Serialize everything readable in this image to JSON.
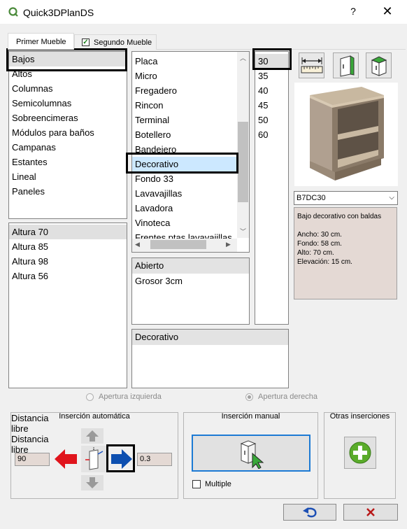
{
  "window": {
    "title": "Quick3DPlanDS",
    "help": "?",
    "close": "✕"
  },
  "tabs": [
    {
      "label": "Primer Mueble"
    },
    {
      "label": "Segundo Mueble",
      "checked": true
    }
  ],
  "categories": [
    "Bajos",
    "Altos",
    "Columnas",
    "Semicolumnas",
    "Sobreencimeras",
    "Módulos para baños",
    "Campanas",
    "Estantes",
    "Lineal",
    "Paneles"
  ],
  "heights": [
    "Altura 70",
    "Altura 85",
    "Altura 98",
    "Altura 56"
  ],
  "subtypes": [
    "Placa",
    "Micro",
    "Fregadero",
    "Rincon",
    "Terminal",
    "Botellero",
    "Bandejero",
    "Decorativo",
    "Fondo 33",
    "Lavavajillas",
    "Lavadora",
    "Vinoteca",
    "Frentes ptas lavavajillas"
  ],
  "widths": [
    "30",
    "35",
    "40",
    "45",
    "50",
    "60"
  ],
  "door": {
    "header": "Abierto",
    "items": [
      "Grosor 3cm"
    ]
  },
  "finish": {
    "header": "Decorativo"
  },
  "code_select": "B7DC30",
  "description": {
    "title": "Bajo decorativo con baldas",
    "lines": [
      "Ancho: 30 cm.",
      "Fondo: 58 cm.",
      "Alto: 70 cm.",
      "Elevación: 15 cm."
    ]
  },
  "radios": {
    "left": "Apertura izquierda",
    "right": "Apertura derecha"
  },
  "auto_insert": {
    "title": "Inserción automática",
    "left_value": "90",
    "right_value": "0.3",
    "left_caption": [
      "Distancia",
      "libre"
    ],
    "right_caption": [
      "Distancia",
      "libre"
    ]
  },
  "manual_insert": {
    "title": "Inserción manual",
    "multiple_label": "Multiple"
  },
  "other_insert": {
    "title": "Otras inserciones"
  },
  "colors": {
    "accent_blue": "#1c7ad4",
    "red_arrow": "#e0141c",
    "selection": "#cce8ff",
    "field_bg": "#e4d9d4"
  }
}
